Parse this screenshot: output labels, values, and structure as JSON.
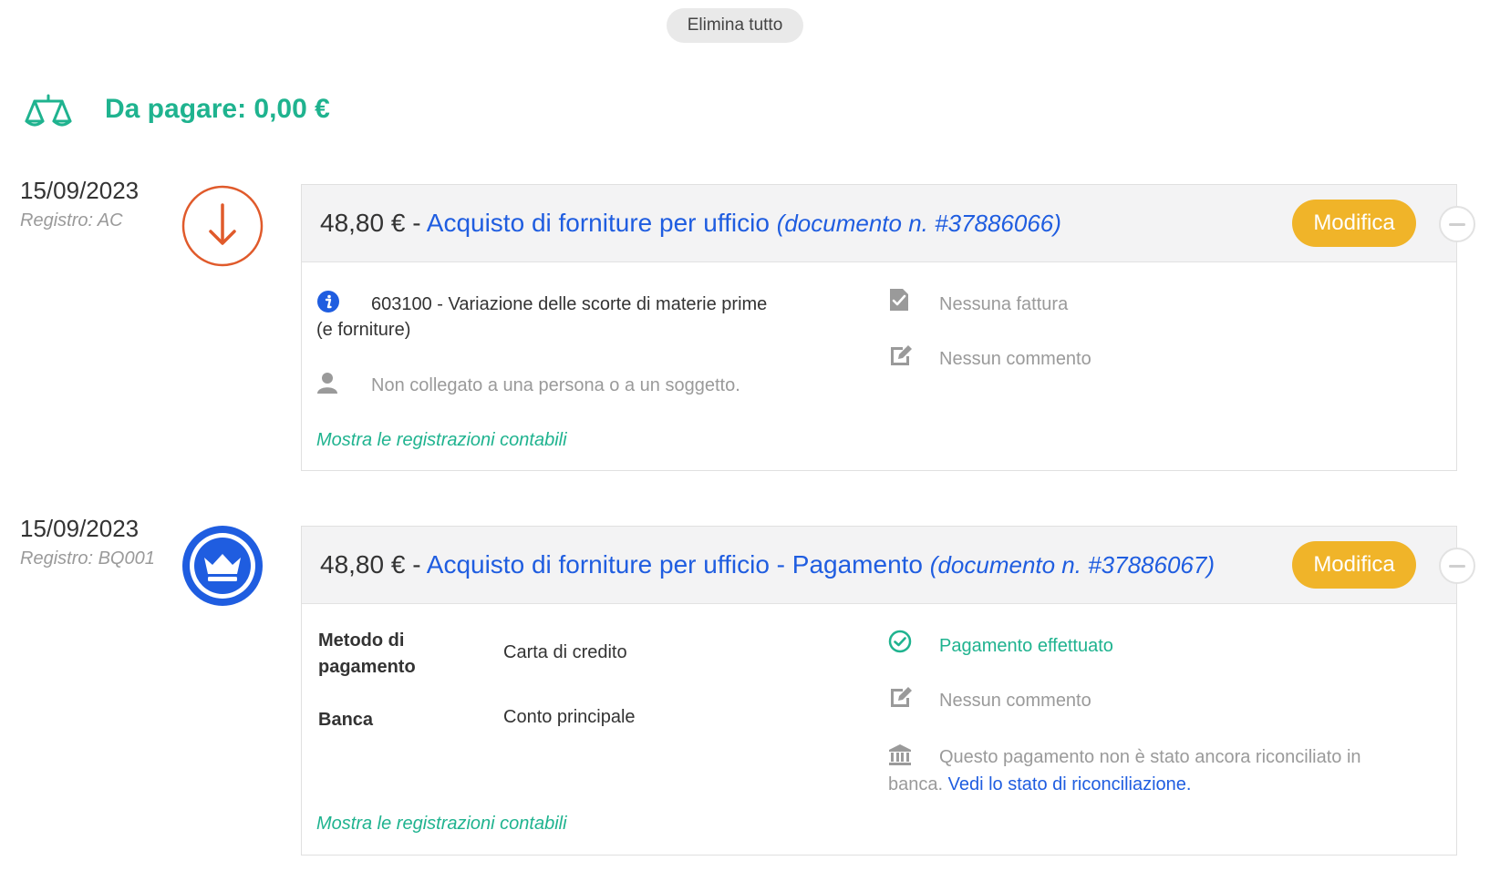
{
  "toolbar": {
    "delete_all_label": "Elimina tutto"
  },
  "balance": {
    "label": "Da pagare: 0,00 €",
    "icon": "scale-icon",
    "color": "#1fb38f"
  },
  "entries": [
    {
      "date": "15/09/2023",
      "register": "Registro: AC",
      "icon": "arrow-down-icon",
      "amount": "48,80 €",
      "separator": "-",
      "title": "Acquisto di forniture per ufficio",
      "document": "(documento n. #37886066)",
      "edit_label": "Modifica",
      "account": "603100 - Variazione delle scorte di materie prime",
      "account_cont": "(e forniture)",
      "person": "Non collegato a una persona o a un soggetto.",
      "invoice": "Nessuna fattura",
      "comment": "Nessun commento",
      "show_entries": "Mostra le registrazioni contabili"
    },
    {
      "date": "15/09/2023",
      "register": "Registro: BQ001",
      "icon": "crown-icon",
      "amount": "48,80 €",
      "separator": "-",
      "title": "Acquisto di forniture per ufficio - Pagamento",
      "document": "(documento n. #37886067)",
      "edit_label": "Modifica",
      "method_label_1": "Metodo di",
      "method_label_2": "pagamento",
      "method_value": "Carta di credito",
      "bank_label": "Banca",
      "bank_value": "Conto principale",
      "status": "Pagamento effettuato",
      "comment": "Nessun commento",
      "reconcile_text_1": "Questo pagamento non è stato ancora riconciliato in",
      "reconcile_text_2": "banca.",
      "reconcile_link": "Vedi lo stato di riconciliazione.",
      "show_entries": "Mostra le registrazioni contabili"
    }
  ],
  "colors": {
    "accent_green": "#1fb38f",
    "link_blue": "#1f5de0",
    "edit_orange": "#f0b429",
    "out_red": "#e05a2b"
  }
}
